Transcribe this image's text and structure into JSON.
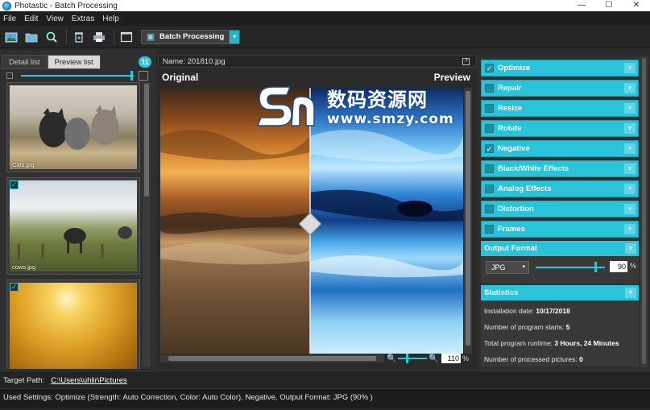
{
  "window": {
    "title": "Photastic - Batch Processing",
    "controls": {
      "minimize": "—",
      "maximize": "☐",
      "close": "✕"
    }
  },
  "menu": {
    "items": [
      "File",
      "Edit",
      "View",
      "Extras",
      "Help"
    ]
  },
  "toolbar": {
    "buttons": [
      "open-image-icon",
      "open-folder-icon",
      "search-icon",
      "delete-icon",
      "print-icon",
      "fullscreen-icon"
    ],
    "batch_label": "Batch Processing",
    "batch_dropdown": "▾"
  },
  "left_panel": {
    "tabs": {
      "detail": "Detail list",
      "preview": "Preview list"
    },
    "count": "11",
    "thumbnails": [
      {
        "caption": "Cats.jpg",
        "checked": false
      },
      {
        "caption": "cows.jpg",
        "checked": true
      },
      {
        "caption": "",
        "checked": true
      }
    ],
    "check_mark": "✓"
  },
  "center": {
    "name_label": "Name: 201810.jpg",
    "original_label": "Original",
    "preview_label": "Preview",
    "zoom_value": "110",
    "zoom_unit": "%",
    "zoom_out": "🔍",
    "zoom_in": "🔍"
  },
  "effects": {
    "items": [
      {
        "label": "Optimize",
        "checked": true
      },
      {
        "label": "Repair",
        "checked": false
      },
      {
        "label": "Resize",
        "checked": false
      },
      {
        "label": "Rotate",
        "checked": false
      },
      {
        "label": "Negative",
        "checked": true
      },
      {
        "label": "Black/White Effects",
        "checked": false
      },
      {
        "label": "Analog Effects",
        "checked": false
      },
      {
        "label": "Distortion",
        "checked": false
      },
      {
        "label": "Frames",
        "checked": false
      }
    ],
    "arrow": "▾",
    "accent_color": "#2ac3d9"
  },
  "output_format": {
    "header": "Output Format",
    "format": "JPG",
    "quality": "90",
    "quality_level": 0.9,
    "unit": "%"
  },
  "statistics": {
    "header": "Statistics",
    "rows": [
      {
        "label": "Installation date:",
        "value": "10/17/2018"
      },
      {
        "label": "Number of program starts:",
        "value": "5"
      },
      {
        "label": "Total program runtime:",
        "value": "3 Hours, 24 Minutes"
      },
      {
        "label": "Number of processed pictures:",
        "value": "0"
      }
    ]
  },
  "bottom": {
    "target_label": "Target Path:",
    "target_path": "C:\\Users\\uhlir\\Pictures",
    "used_settings": "Used Settings: Optimize (Strength: Auto Correction, Color: Auto Color), Negative, Output Format: JPG (90% )"
  },
  "watermark": {
    "text_cn": "数码资源网",
    "url": "www.smzy.com"
  }
}
